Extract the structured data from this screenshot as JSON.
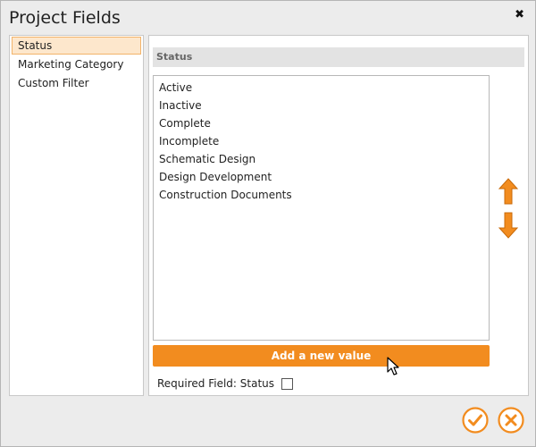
{
  "window": {
    "title": "Project Fields",
    "close_glyph": "✖"
  },
  "left_panel": {
    "items": [
      {
        "label": "Status",
        "selected": true
      },
      {
        "label": "Marketing Category",
        "selected": false
      },
      {
        "label": "Custom Filter",
        "selected": false
      }
    ]
  },
  "right_panel": {
    "header": "Status",
    "values": [
      "Active",
      "Inactive",
      "Complete",
      "Incomplete",
      "Schematic Design",
      "Design Development",
      "Construction Documents"
    ],
    "add_button_label": "Add a new value",
    "required_label": "Required Field: Status",
    "required_checked": false
  },
  "icons": {
    "move_up": "arrow-up-icon",
    "move_down": "arrow-down-icon",
    "ok": "check-icon",
    "cancel": "cancel-icon"
  },
  "colors": {
    "accent": "#f28c1f",
    "selection_bg": "#fde7cc",
    "selection_border": "#f2b36a"
  }
}
